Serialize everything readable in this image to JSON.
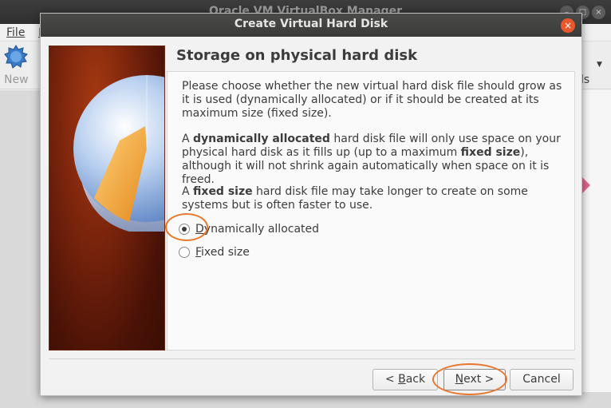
{
  "background_window": {
    "title": "Oracle VM VirtualBox Manager",
    "menu": [
      "File",
      "M"
    ],
    "toolbar_new_label": "New",
    "right_tools_label": "ls"
  },
  "dialog": {
    "title": "Create Virtual Hard Disk",
    "heading": "Storage on physical hard disk",
    "paragraph1": "Please choose whether the new virtual hard disk file should grow as it is used (dynamically allocated) or if it should be created at its maximum size (fixed size).",
    "paragraph2": {
      "p1": "A ",
      "b1": "dynamically allocated",
      "p2": " hard disk file will only use space on your physical hard disk as it fills up (up to a maximum ",
      "b2": "fixed size",
      "p3": "), although it will not shrink again automatically when space on it is freed."
    },
    "paragraph3": {
      "p1": "A ",
      "b1": "fixed size",
      "p2": " hard disk file may take longer to create on some systems but is often faster to use."
    },
    "options": [
      {
        "mnemonic": "D",
        "rest": "ynamically allocated",
        "checked": true
      },
      {
        "mnemonic": "F",
        "rest": "ixed size",
        "checked": false
      }
    ],
    "buttons": {
      "back": {
        "pre": "< ",
        "mnemonic": "B",
        "rest": "ack"
      },
      "next": {
        "mnemonic": "N",
        "rest": "ext >"
      },
      "cancel": "Cancel"
    }
  },
  "colors": {
    "accent_highlight": "#e8772e",
    "close_button": "#e9582d",
    "titlebar": "#3b3b39"
  }
}
